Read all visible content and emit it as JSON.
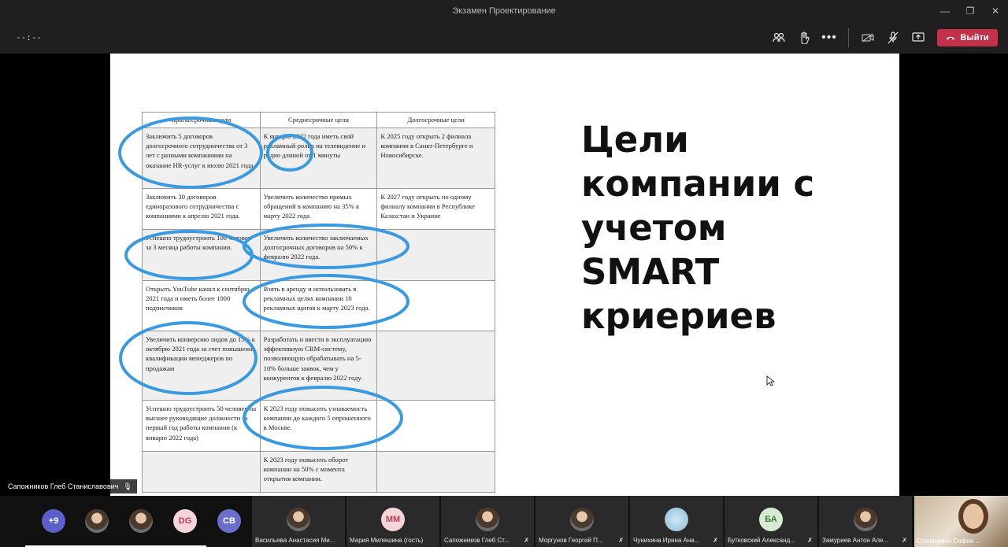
{
  "window": {
    "title": "Экзамен Проектирование",
    "controls": [
      "minimize-icon",
      "restore-icon",
      "close-icon"
    ]
  },
  "toolbar": {
    "timer": "--:--",
    "icons": [
      "participants-icon",
      "raise-hand-icon",
      "more-icon",
      "camera-off-icon",
      "mic-off-icon",
      "share-screen-icon"
    ],
    "leave_label": "Выйти",
    "leave_color": "#c4314b"
  },
  "slide": {
    "title": [
      "Цели",
      "компании с",
      "учетом",
      "SMART",
      "криериев"
    ],
    "table": {
      "headers": [
        "Краткосрочные цели",
        "Среднесрочные цели",
        "Долгосрочные цели"
      ],
      "rows": [
        [
          "Заключить 5 договоров долгосрочного сотрудничества от 3 лет с разными компаниями на оказание HR-услуг к июлю 2021 года.",
          "К январю 2022 года иметь свой рекламный ролик на телевидение и радио длиной от 1 минуты",
          "К 2025 году открыть 2 филиала компании в Санкт-Петербурге и Новосибирске."
        ],
        [
          "Заключить 30 договоров единоразового сотрудничества с компаниями к апрелю 2021 года.",
          "Увеличить количество прямых обращений в компанию на 35% к марту 2022 года",
          "К 2027 году открыть по одному филиалу компании в Республике Казахстан и Украине"
        ],
        [
          "Успешно трудоустроить 100 человек за 3 месяца работы компании.",
          "Увеличить количество заключаемых долгосрочных договоров на 50% к февралю 2022 года.",
          ""
        ],
        [
          "Открыть YouTube канал к сентябрю 2021 года и иметь более 1000 подписчиков",
          "Взять в аренду и использовать в рекламных целях компании 10 рекламных щитов к марту 2023 года.",
          ""
        ],
        [
          "Увеличить конверсию лидов до 15% к октябрю 2021 года за счет повышения квалификации менеджеров по продажам",
          "Разработать и ввести в эксплуатацию эффективную CRM-систему, позволяющую обрабатывать на 5-10% больше заявок, чем у конкурентов к февралю 2022 году.",
          ""
        ],
        [
          "Успешно трудоустроить 50 человек на высшее руководящие должности за первый год работы компании (к январю 2022 года)",
          "К 2023 году повысить узнаваемость компании до каждого 5 опрошенного в Москве.",
          ""
        ],
        [
          "",
          "К 2023 году повысить оборот компании на 50% с момента открытия компании.",
          ""
        ]
      ]
    },
    "annotation_color": "#3a9ae0"
  },
  "presenter": {
    "name": "Сапожников Глеб Станиславович"
  },
  "participants": {
    "overflow": "+9",
    "avatars": [
      {
        "initials": "DG",
        "bg": "#f5d5d8",
        "fg": "#b8405c"
      },
      {
        "initials": "CB",
        "bg": "#6b6fc9",
        "fg": "#ffffff"
      }
    ],
    "tiles": [
      {
        "name": "Васильева Анастасия Ми...",
        "initials": ""
      },
      {
        "name": "Мария Милешина (гость)",
        "initials": "MM"
      },
      {
        "name": "Сапожников Глеб Ст...",
        "initials": ""
      },
      {
        "name": "Моргунов Георгий П...",
        "initials": ""
      },
      {
        "name": "Чунихина Ирина Ана...",
        "initials": ""
      },
      {
        "name": "Бутковский Александ...",
        "initials": "БА"
      },
      {
        "name": "Замуриев Антон Але...",
        "initials": ""
      }
    ],
    "self": {
      "name": "Степанович София ..."
    }
  }
}
